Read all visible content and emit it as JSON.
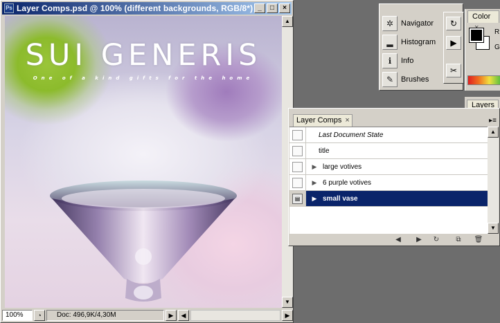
{
  "document": {
    "title": "Layer Comps.psd @ 100% (different backgrounds, RGB/8*)",
    "canvas_title": "SUI GENERIS",
    "canvas_tagline": "One of a kind gifts for the home",
    "zoom": "100%",
    "doc_info": "Doc: 496,9K/4,30M"
  },
  "palettes": {
    "items": [
      {
        "label": "Navigator",
        "icon": "navigator-icon"
      },
      {
        "label": "Histogram",
        "icon": "histogram-icon"
      },
      {
        "label": "Info",
        "icon": "info-icon"
      },
      {
        "label": "Brushes",
        "icon": "brushes-icon"
      }
    ],
    "color_tab": "Color",
    "color_close": "×",
    "rgb": {
      "r": "R",
      "g": "G"
    },
    "layers_tab": "Layers",
    "colors": {
      "foreground": "#000000",
      "background": "#ffffff"
    }
  },
  "layer_comps": {
    "tab_label": "Layer Comps",
    "close": "×",
    "rows": [
      {
        "label": "Last Document State",
        "style": "italic",
        "expandable": false,
        "selected": false
      },
      {
        "label": "title",
        "style": "plain",
        "expandable": false,
        "selected": false
      },
      {
        "label": "large votives",
        "style": "normal",
        "expandable": true,
        "selected": false
      },
      {
        "label": "6 purple votives",
        "style": "normal",
        "expandable": true,
        "selected": false
      },
      {
        "label": "small vase",
        "style": "normal",
        "expandable": true,
        "selected": true
      }
    ]
  },
  "accent": {
    "titlebar_start": "#0a246a",
    "titlebar_end": "#a6caf0",
    "selection": "#0a246a"
  }
}
